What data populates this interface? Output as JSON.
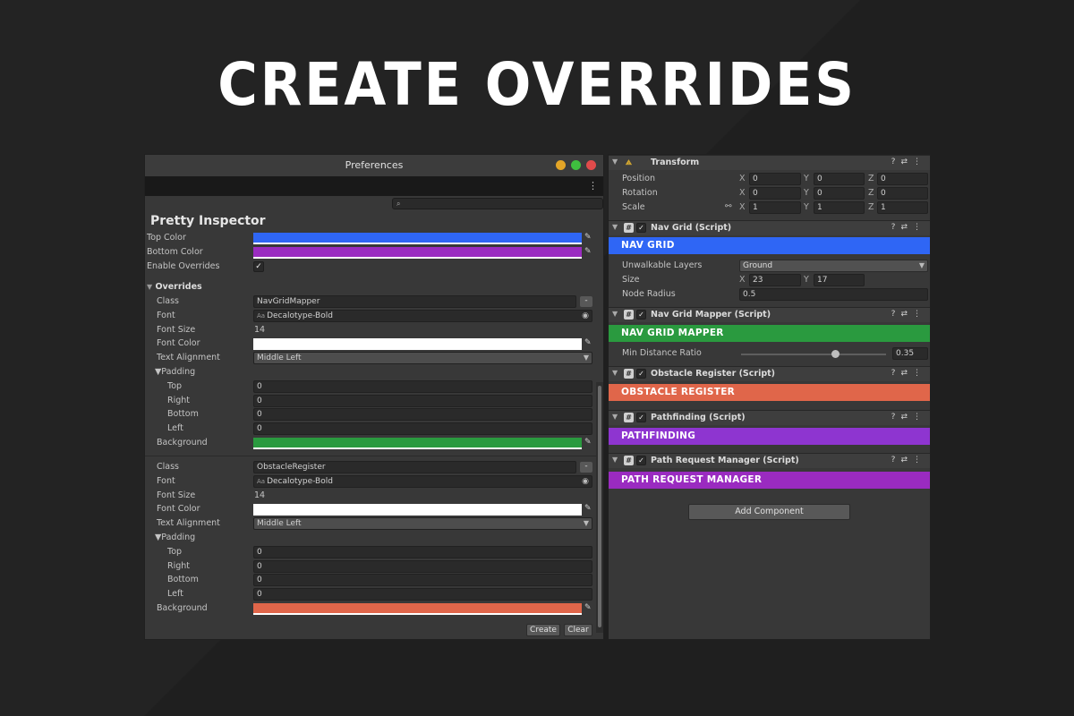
{
  "headline": "CREATE OVERRIDES",
  "preferences": {
    "window_title": "Preferences",
    "section_title": "Pretty Inspector",
    "top_color_label": "Top Color",
    "top_color": "#2f66f5",
    "bottom_color_label": "Bottom Color",
    "bottom_color": "#9a2bc0",
    "enable_overrides_label": "Enable Overrides",
    "enable_overrides_checked": "✓",
    "overrides_label": "Overrides",
    "overrides": [
      {
        "class_label": "Class",
        "class_value": "NavGridMapper",
        "font_label": "Font",
        "font_value": "Decalotype-Bold",
        "font_size_label": "Font Size",
        "font_size_value": "14",
        "font_color_label": "Font Color",
        "font_color": "#ffffff",
        "text_alignment_label": "Text Alignment",
        "text_alignment_value": "Middle Left",
        "padding_label": "Padding",
        "top_label": "Top",
        "top_value": "0",
        "right_label": "Right",
        "right_value": "0",
        "bottom_label": "Bottom",
        "bottom_value": "0",
        "left_label": "Left",
        "left_value": "0",
        "background_label": "Background",
        "background": "#2a9a3f"
      },
      {
        "class_label": "Class",
        "class_value": "ObstacleRegister",
        "font_label": "Font",
        "font_value": "Decalotype-Bold",
        "font_size_label": "Font Size",
        "font_size_value": "14",
        "font_color_label": "Font Color",
        "font_color": "#ffffff",
        "text_alignment_label": "Text Alignment",
        "text_alignment_value": "Middle Left",
        "padding_label": "Padding",
        "top_label": "Top",
        "top_value": "0",
        "right_label": "Right",
        "right_value": "0",
        "bottom_label": "Bottom",
        "bottom_value": "0",
        "left_label": "Left",
        "left_value": "0",
        "background_label": "Background",
        "background": "#e0664a"
      }
    ],
    "create_label": "Create",
    "clear_label": "Clear"
  },
  "inspector": {
    "transform": {
      "title": "Transform",
      "position_label": "Position",
      "position": [
        "0",
        "0",
        "0"
      ],
      "rotation_label": "Rotation",
      "rotation": [
        "0",
        "0",
        "0"
      ],
      "scale_label": "Scale",
      "scale": [
        "1",
        "1",
        "1"
      ]
    },
    "nav_grid": {
      "title": "Nav Grid (Script)",
      "banner": "NAV GRID",
      "banner_color": "#2f66f5",
      "unwalkable_label": "Unwalkable Layers",
      "unwalkable_value": "Ground",
      "size_label": "Size",
      "size_x": "23",
      "size_y": "17",
      "node_radius_label": "Node Radius",
      "node_radius_value": "0.5"
    },
    "nav_grid_mapper": {
      "title": "Nav Grid Mapper (Script)",
      "banner": "NAV GRID MAPPER",
      "banner_color": "#2a9a3f",
      "min_distance_label": "Min Distance Ratio",
      "min_distance_value": "0.35",
      "min_distance_fraction": 0.65
    },
    "obstacle_register": {
      "title": "Obstacle Register (Script)",
      "banner": "OBSTACLE REGISTER",
      "banner_color": "#e0664a"
    },
    "pathfinding": {
      "title": "Pathfinding (Script)",
      "banner": "PATHFINDING",
      "banner_color": "#8e35d0"
    },
    "path_request_manager": {
      "title": "Path Request Manager (Script)",
      "banner": "PATH REQUEST MANAGER",
      "banner_color": "#9a2bc0"
    },
    "add_component_label": "Add Component"
  }
}
